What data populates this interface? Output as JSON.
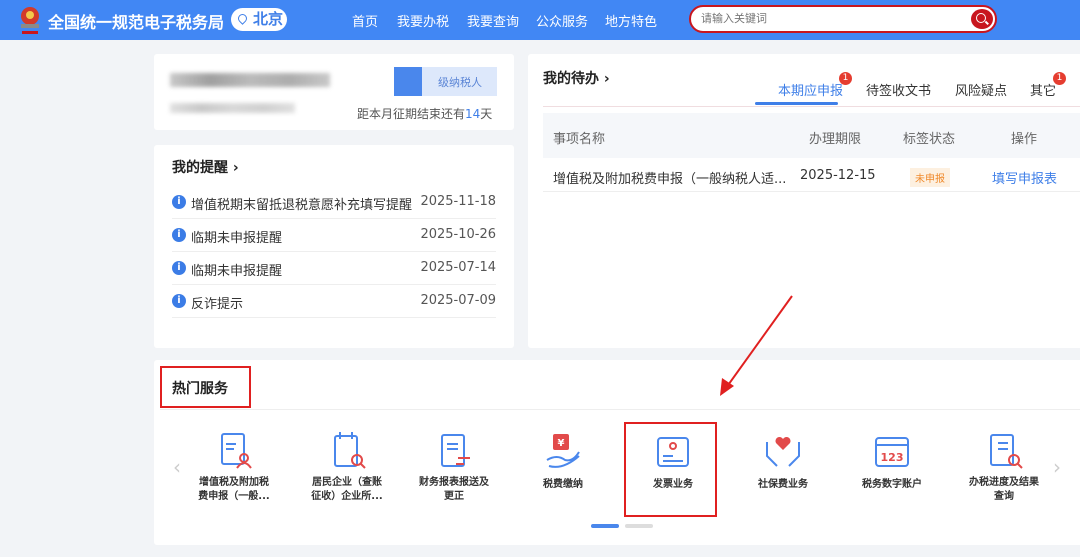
{
  "header": {
    "title": "全国统一规范电子税务局",
    "city": "北京",
    "nav": [
      "首页",
      "我要办税",
      "我要查询",
      "公众服务",
      "地方特色"
    ],
    "search_placeholder": "请输入关键词"
  },
  "profile": {
    "taxpayer_type": "级纳税人",
    "deadline_prefix": "距本月征期结束还有",
    "deadline_days": "14",
    "deadline_suffix": "天"
  },
  "reminders": {
    "title": "我的提醒 ›",
    "items": [
      {
        "text": "增值税期末留抵退税意愿补充填写提醒",
        "date": "2025-11-18"
      },
      {
        "text": "临期未申报提醒",
        "date": "2025-10-26"
      },
      {
        "text": "临期未申报提醒",
        "date": "2025-07-14"
      },
      {
        "text": "反诈提示",
        "date": "2025-07-09"
      }
    ]
  },
  "todo": {
    "title": "我的待办 ›",
    "tabs": [
      {
        "label": "本期应申报",
        "badge": "1"
      },
      {
        "label": "待签收文书"
      },
      {
        "label": "风险疑点"
      },
      {
        "label": "其它",
        "badge": "1"
      }
    ],
    "columns": [
      "事项名称",
      "办理期限",
      "标签状态",
      "操作"
    ],
    "rows": [
      {
        "name": "增值税及附加税费申报（一般纳税人适...",
        "deadline": "2025-12-15",
        "status": "未申报",
        "action": "填写申报表"
      }
    ]
  },
  "hot": {
    "title": "热门服务",
    "services": [
      {
        "l1": "增值税及附加税",
        "l2": "费申报（一般..."
      },
      {
        "l1": "居民企业（查账",
        "l2": "征收）企业所..."
      },
      {
        "l1": "财务报表报送及",
        "l2": "更正"
      },
      {
        "l1": "税费缴纳",
        "l2": ""
      },
      {
        "l1": "发票业务",
        "l2": ""
      },
      {
        "l1": "社保费业务",
        "l2": ""
      },
      {
        "l1": "税务数字账户",
        "l2": ""
      },
      {
        "l1": "办税进度及结果",
        "l2": "查询"
      }
    ]
  },
  "colors": {
    "header": "#4187f4",
    "accent": "#3f7fe8",
    "annotation": "#e02020"
  }
}
